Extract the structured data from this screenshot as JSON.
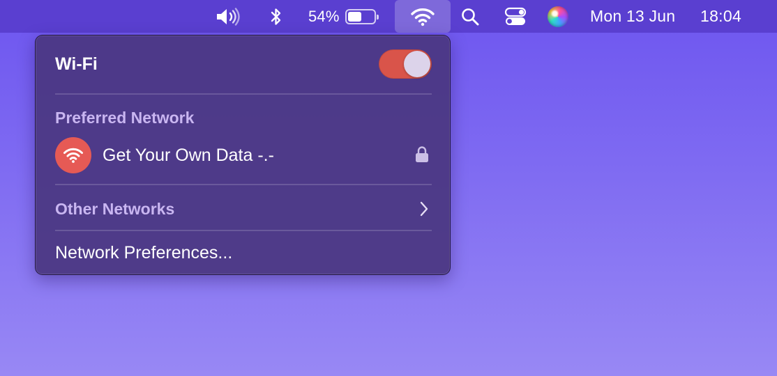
{
  "menubar": {
    "volume_icon": "speaker-volume-icon",
    "bluetooth_icon": "bluetooth-icon",
    "battery": {
      "percent_label": "54%",
      "level": 0.54
    },
    "wifi_icon": "wifi-icon",
    "search_icon": "spotlight-search-icon",
    "control_center_icon": "control-center-icon",
    "siri_icon": "siri-icon",
    "date": "Mon 13 Jun",
    "time": "18:04"
  },
  "wifi_menu": {
    "title": "Wi-Fi",
    "toggle_on": true,
    "toggle_color": "#d9544a",
    "preferred_label": "Preferred Network",
    "preferred_network": {
      "name": "Get Your Own Data -.-",
      "icon": "wifi-icon",
      "icon_bg": "#e65a55",
      "secured": true,
      "lock_icon": "lock-icon"
    },
    "other_networks_label": "Other Networks",
    "network_prefs_label": "Network Preferences..."
  }
}
